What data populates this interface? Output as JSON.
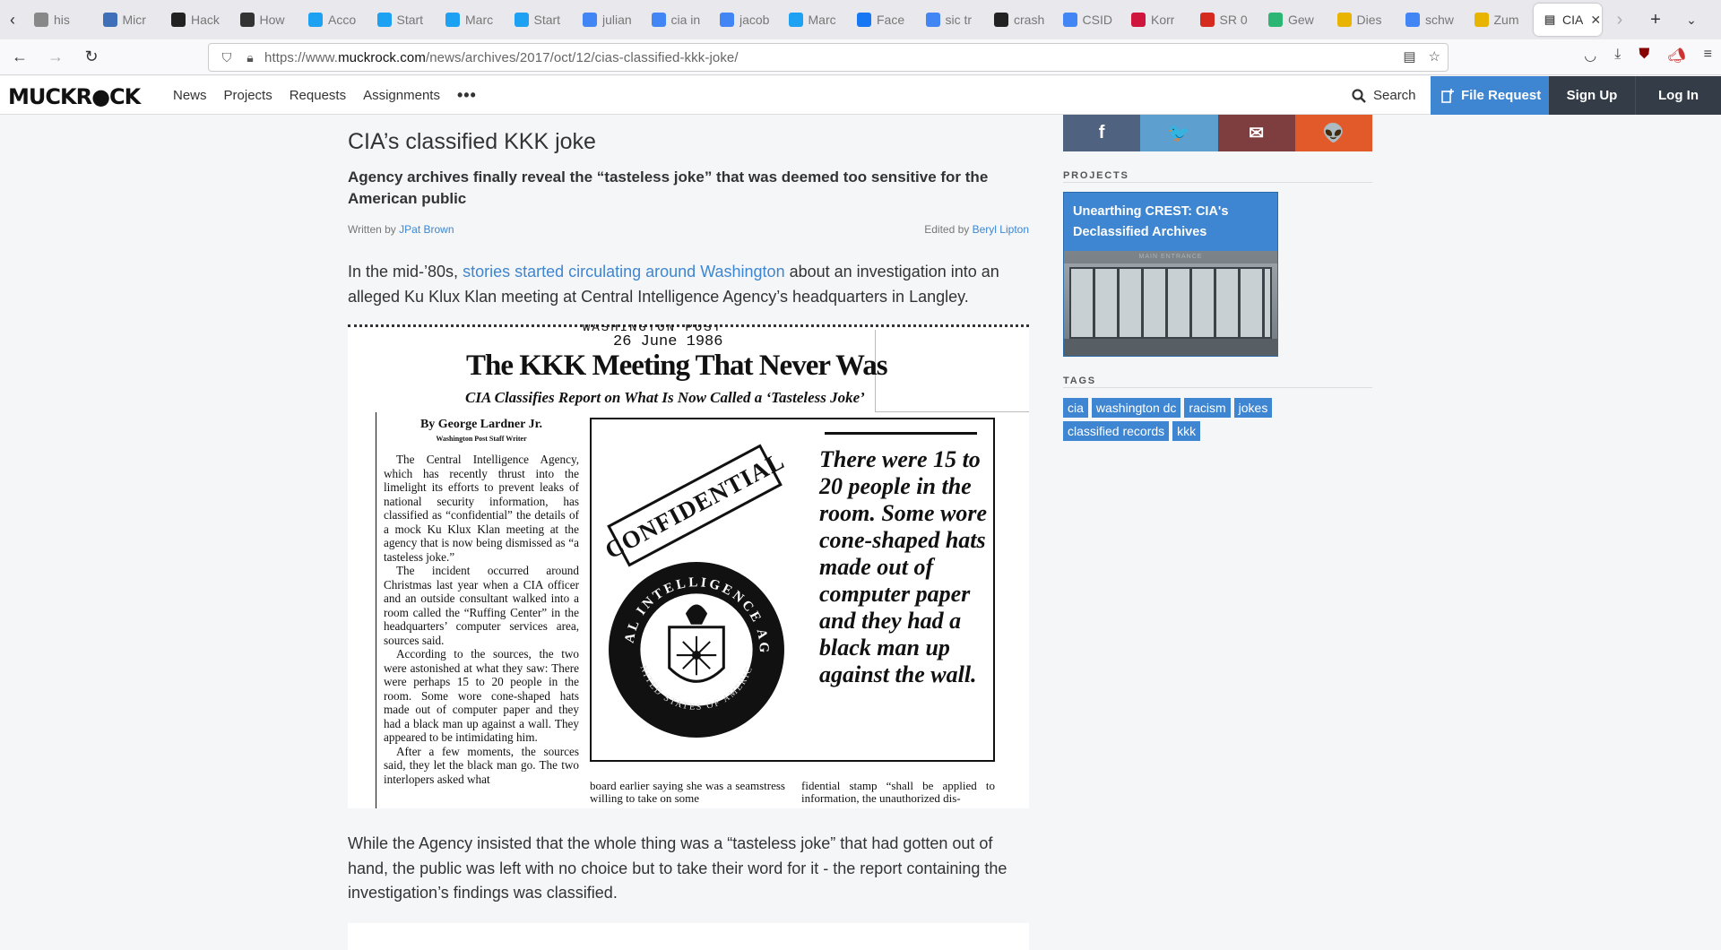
{
  "browser": {
    "tabs": [
      {
        "label": "his",
        "icon": "history-icon",
        "color": "#888"
      },
      {
        "label": "Micr",
        "icon": "microsoft-edge-icon",
        "color": "#3e6fb8"
      },
      {
        "label": "Hack",
        "icon": "github-icon",
        "color": "#222"
      },
      {
        "label": "How",
        "icon": "howstuffworks-icon",
        "color": "#333"
      },
      {
        "label": "Acco",
        "icon": "twitter-icon",
        "color": "#1da1f2"
      },
      {
        "label": "Start",
        "icon": "twitter-icon",
        "color": "#1da1f2"
      },
      {
        "label": "Marc",
        "icon": "twitter-icon",
        "color": "#1da1f2"
      },
      {
        "label": "Start",
        "icon": "twitter-icon",
        "color": "#1da1f2"
      },
      {
        "label": "julian",
        "icon": "google-icon",
        "color": "#4285f4"
      },
      {
        "label": "cia in",
        "icon": "google-icon",
        "color": "#4285f4"
      },
      {
        "label": "jacob",
        "icon": "google-icon",
        "color": "#4285f4"
      },
      {
        "label": "Marc",
        "icon": "twitter-icon",
        "color": "#1da1f2"
      },
      {
        "label": "Face",
        "icon": "facebook-icon",
        "color": "#1877f2"
      },
      {
        "label": "sic tr",
        "icon": "google-icon",
        "color": "#4285f4"
      },
      {
        "label": "crash",
        "icon": "github-icon",
        "color": "#222"
      },
      {
        "label": "CSID",
        "icon": "google-icon",
        "color": "#4285f4"
      },
      {
        "label": "Korr",
        "icon": "news-icon",
        "color": "#d0153d"
      },
      {
        "label": "SR 0",
        "icon": "swiss-icon",
        "color": "#d52b1e"
      },
      {
        "label": "Gew",
        "icon": "heart-icon",
        "color": "#2bb673"
      },
      {
        "label": "Dies",
        "icon": "w-icon",
        "color": "#e8b400"
      },
      {
        "label": "schw",
        "icon": "google-icon",
        "color": "#4285f4"
      },
      {
        "label": "Zum",
        "icon": "w-icon",
        "color": "#e8b400"
      }
    ],
    "active_tab": {
      "label": "CIA"
    },
    "url_prefix": "https://www.",
    "url_domain": "muckrock.com",
    "url_path": "/news/archives/2017/oct/12/cias-classified-kkk-joke/"
  },
  "site": {
    "logo": "MUCKR●CK",
    "nav": [
      "News",
      "Projects",
      "Requests",
      "Assignments"
    ],
    "more": "•••",
    "search_label": "Search",
    "file_request_label": "File Request",
    "signup_label": "Sign Up",
    "login_label": "Log In",
    "colors": {
      "accent": "#3e86d1",
      "dark": "#333c47"
    }
  },
  "article": {
    "title": "CIA’s classified KKK joke",
    "subtitle": "Agency archives finally reveal the “tasteless joke” that was deemed too sensitive for the American public",
    "written_by_label": "Written by ",
    "author": "JPat Brown",
    "edited_by_label": "Edited by ",
    "editor": "Beryl Lipton",
    "para1_before": "In the mid-’80s, ",
    "para1_link": "stories started circulating around Washington",
    "para1_after": " about an investigation into an alleged Ku Klux Klan meeting at Central Intelligence Agency’s headquarters in Langley.",
    "para2": "While the Agency insisted that the whole thing was a “tasteless joke” that had gotten out of hand, the public was left with no choice but to take their word for it - the report containing the investigation’s findings was classified."
  },
  "clipping": {
    "top_text": "WASHINGTON POST",
    "date": "26 June 1986",
    "headline": "The KKK Meeting That Never Was",
    "deck": "CIA Classifies Report on What Is Now Called a ‘Tasteless Joke’",
    "author": "By George Lardner Jr.",
    "staff": "Washington Post Staff Writer",
    "col1_paragraphs": [
      "The Central Intelligence Agency, which has recently thrust into the limelight its efforts to prevent leaks of national security information, has classified as “confidential” the details of a mock Ku Klux Klan meeting at the agency that is now being dismissed as “a tasteless joke.”",
      "The incident occurred around Christmas last year when a CIA officer and an outside consultant walked into a room called the “Ruffing Center” in the headquarters’ computer services area, sources said.",
      "According to the sources, the two were astonished at what they saw: There were perhaps 15 to 20 people in the room. Some wore cone-shaped hats made out of computer paper and they had a black man up against a wall. They appeared to be intimidating him.",
      "After a few moments, the sources said, they let the black man go. The two interlopers asked what"
    ],
    "stamp": "CONFIDENTIAL",
    "seal_text": "CENTRAL INTELLIGENCE AGENCY",
    "seal_bottom": "UNITED STATES OF AMERICA",
    "pull_quote": "There were 15 to 20 people in the room. Some wore cone-shaped hats made out of computer paper and they had a black man up against the wall.",
    "col2": "board earlier saying she was a seamstress willing to take on some",
    "col3": "fidential stamp “shall be applied to information, the unauthorized dis-"
  },
  "sidebar": {
    "share": [
      {
        "label": "f",
        "icon": "facebook-icon",
        "color": "#4f6380"
      },
      {
        "label": "🐦",
        "icon": "twitter-icon",
        "color": "#5d9fce"
      },
      {
        "label": "✉",
        "icon": "email-icon",
        "color": "#7e3d3f"
      },
      {
        "label": "👽",
        "icon": "reddit-icon",
        "color": "#e2592a"
      }
    ],
    "projects_heading": "PROJECTS",
    "project_title": "Unearthing CREST: CIA's Declassified Archives",
    "project_image_caption": "MAIN ENTRANCE",
    "tags_heading": "TAGS",
    "tags": [
      "cia",
      "washington dc",
      "racism",
      "jokes",
      "classified records",
      "kkk"
    ]
  }
}
